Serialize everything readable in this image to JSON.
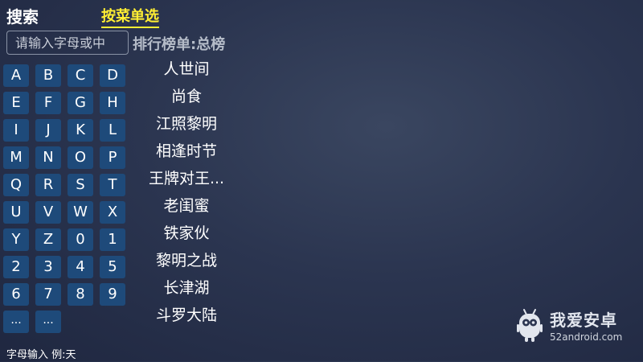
{
  "header": {
    "title": "搜索",
    "menu_tab": "按菜单选",
    "accent_color": "#ffee33"
  },
  "search": {
    "placeholder": "请输入字母或中",
    "value": ""
  },
  "keyboard": {
    "key_color": "#1e4a7a",
    "keys": [
      "A",
      "B",
      "C",
      "D",
      "E",
      "F",
      "G",
      "H",
      "I",
      "J",
      "K",
      "L",
      "M",
      "N",
      "O",
      "P",
      "Q",
      "R",
      "S",
      "T",
      "U",
      "V",
      "W",
      "X",
      "Y",
      "Z",
      "0",
      "1",
      "2",
      "3",
      "4",
      "5",
      "6",
      "7",
      "8",
      "9",
      "...",
      "..."
    ]
  },
  "hint": "字母输入 例:天",
  "ranking": {
    "title": "排行榜单:总榜",
    "items": [
      "人世间",
      "尚食",
      "江照黎明",
      "相逢时节",
      "王牌对王...",
      "老闺蜜",
      "铁家伙",
      "黎明之战",
      "长津湖",
      "斗罗大陆"
    ]
  },
  "watermark": {
    "brand": "我爱安卓",
    "url": "52android.com",
    "icon": "android-robot-icon"
  }
}
